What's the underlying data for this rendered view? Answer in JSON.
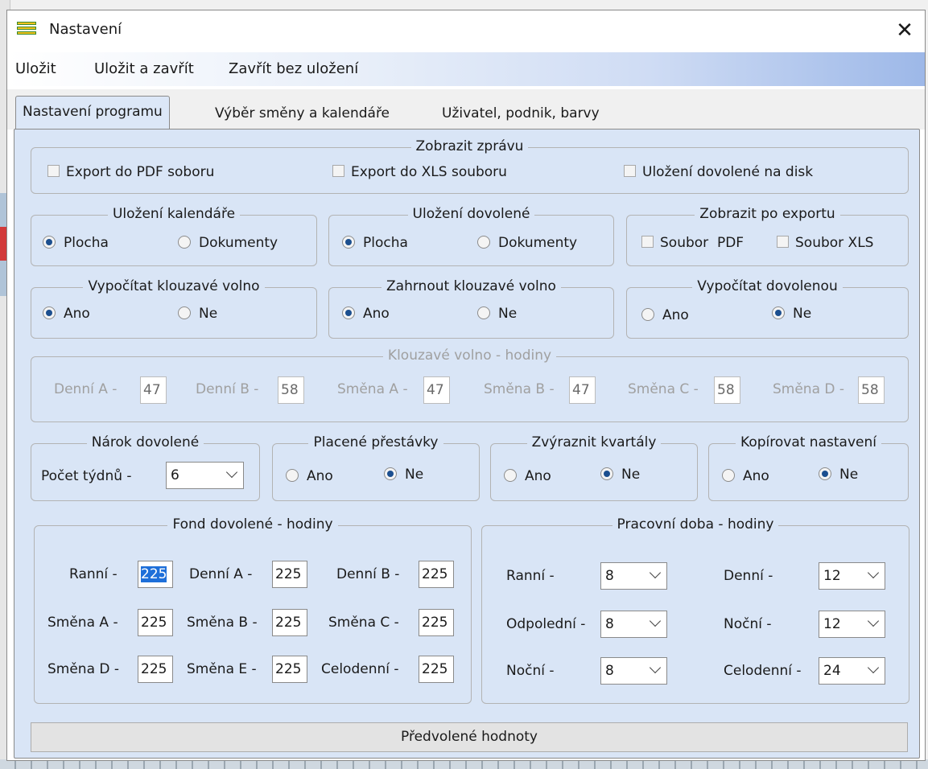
{
  "window": {
    "title": "Nastavení",
    "close_glyph": "✕"
  },
  "menu": [
    "Uložit",
    "Uložit a zavřít",
    "Zavřít bez uložení"
  ],
  "tabs": [
    "Nastavení programu",
    "Výběr směny a kalendáře",
    "Uživatel, podnik, barvy"
  ],
  "zobrazit_zpravu": {
    "legend": "Zobrazit zprávu",
    "options": [
      "Export do PDF soboru",
      "Export do XLS souboru",
      "Uložení dovolené na disk"
    ]
  },
  "ulozeni_kalendare": {
    "legend": "Uložení kalendáře",
    "options": [
      "Plocha",
      "Dokumenty"
    ],
    "selected": "Plocha"
  },
  "ulozeni_dovolene": {
    "legend": "Uložení dovolené",
    "options": [
      "Plocha",
      "Dokumenty"
    ],
    "selected": "Plocha"
  },
  "zobrazit_po_exportu": {
    "legend": "Zobrazit po exportu",
    "options": [
      "Soubor  PDF",
      "Soubor XLS"
    ]
  },
  "vypocitat_klouzave": {
    "legend": "Vypočítat klouzavé volno",
    "options": [
      "Ano",
      "Ne"
    ],
    "selected": "Ano"
  },
  "zahrnout_klouzave": {
    "legend": "Zahrnout klouzavé volno",
    "options": [
      "Ano",
      "Ne"
    ],
    "selected": "Ano"
  },
  "vypocitat_dovolenou": {
    "legend": "Vypočítat dovolenou",
    "options": [
      "Ano",
      "Ne"
    ],
    "selected": "Ne"
  },
  "klouzave_hodiny": {
    "legend": "Klouzavé volno - hodiny",
    "fields": [
      {
        "label": "Denní A -",
        "value": "47"
      },
      {
        "label": "Denní B -",
        "value": "58"
      },
      {
        "label": "Směna A -",
        "value": "47"
      },
      {
        "label": "Směna B -",
        "value": "47"
      },
      {
        "label": "Směna C -",
        "value": "58"
      },
      {
        "label": "Směna D -",
        "value": "58"
      }
    ]
  },
  "narok_dovolene": {
    "legend": "Nárok dovolené",
    "label": "Počet týdnů -",
    "value": "6"
  },
  "placene_prestavky": {
    "legend": "Placené přestávky",
    "options": [
      "Ano",
      "Ne"
    ],
    "selected": "Ne"
  },
  "zvyraznit_kvartaly": {
    "legend": "Zvýraznit kvartály",
    "options": [
      "Ano",
      "Ne"
    ],
    "selected": "Ne"
  },
  "kopirovat_nastaveni": {
    "legend": "Kopírovat nastavení",
    "options": [
      "Ano",
      "Ne"
    ],
    "selected": "Ne"
  },
  "fond_dovolene": {
    "legend": "Fond dovolené - hodiny",
    "fields": [
      {
        "label": "Ranní -",
        "value": "225"
      },
      {
        "label": "Denní A -",
        "value": "225"
      },
      {
        "label": "Denní B -",
        "value": "225"
      },
      {
        "label": "Směna A -",
        "value": "225"
      },
      {
        "label": "Směna B -",
        "value": "225"
      },
      {
        "label": "Směna C -",
        "value": "225"
      },
      {
        "label": "Směna D -",
        "value": "225"
      },
      {
        "label": "Směna E -",
        "value": "225"
      },
      {
        "label": "Celodenní -",
        "value": "225"
      }
    ]
  },
  "pracovni_doba": {
    "legend": "Pracovní doba - hodiny",
    "fields": [
      {
        "label": "Ranní -",
        "value": "8"
      },
      {
        "label": "Denní -",
        "value": "12"
      },
      {
        "label": "Odpolední -",
        "value": "8"
      },
      {
        "label": "Noční -",
        "value": "12"
      },
      {
        "label": "Noční -",
        "value": "8"
      },
      {
        "label": "Celodenní -",
        "value": "24"
      }
    ]
  },
  "defaults_button": "Předvolené hodnoty",
  "colors": {
    "panel": "#d9e5f6",
    "selection": "#1e6fd9",
    "menubar_end": "#9db8e8"
  },
  "icons": {
    "app": "list-icon",
    "close": "close-icon",
    "dropdown": "chevron-down-icon"
  }
}
